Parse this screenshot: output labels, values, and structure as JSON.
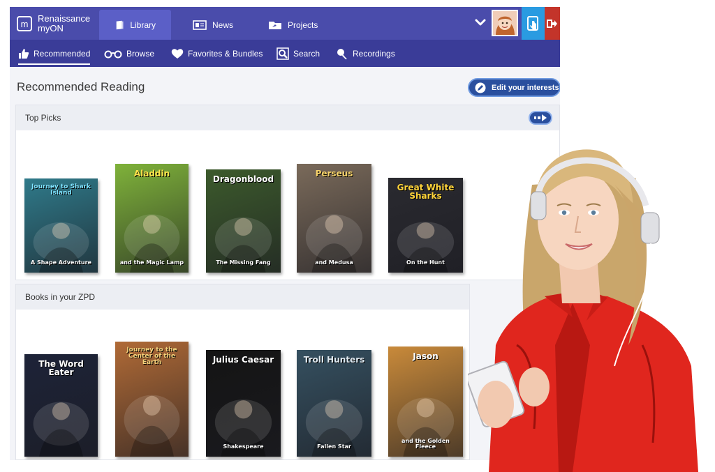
{
  "brand": {
    "line1": "Renaissance",
    "line2": "myON"
  },
  "main_tabs": [
    {
      "label": "Library",
      "icon": "book-icon",
      "active": true
    },
    {
      "label": "News",
      "icon": "newspaper-icon",
      "active": false
    },
    {
      "label": "Projects",
      "icon": "folder-icon",
      "active": false
    }
  ],
  "sub_nav": [
    {
      "label": "Recommended",
      "icon": "thumbs-up-icon",
      "active": true
    },
    {
      "label": "Browse",
      "icon": "glasses-icon"
    },
    {
      "label": "Favorites & Bundles",
      "icon": "heart-icon"
    },
    {
      "label": "Search",
      "icon": "search-icon"
    },
    {
      "label": "Recordings",
      "icon": "microphone-icon"
    }
  ],
  "page": {
    "title": "Recommended Reading",
    "edit_interests_label": "Edit your interests"
  },
  "sections": [
    {
      "title": "Top Picks",
      "books": [
        {
          "title": "Journey to Shark Island",
          "subtitle": "A Shape Adventure",
          "color": "#2f7a8a"
        },
        {
          "title": "Aladdin",
          "subtitle": "and the Magic Lamp",
          "color": "#7fb23a"
        },
        {
          "title": "Dragonblood",
          "subtitle": "The Missing Fang",
          "color": "#3c5a2c"
        },
        {
          "title": "Perseus",
          "subtitle": "and Medusa",
          "color": "#7a6a5a"
        },
        {
          "title": "Great White Sharks",
          "subtitle": "On the Hunt",
          "color": "#2a2a30"
        }
      ]
    },
    {
      "title": "Books in your ZPD",
      "books": [
        {
          "title": "The Word Eater",
          "subtitle": "",
          "color": "#1d2338"
        },
        {
          "title": "Journey to the Center of the Earth",
          "subtitle": "",
          "color": "#b06a36"
        },
        {
          "title": "Julius Caesar",
          "subtitle": "Shakespeare",
          "color": "#141414"
        },
        {
          "title": "Troll Hunters",
          "subtitle": "Fallen Star",
          "color": "#355060"
        },
        {
          "title": "Jason",
          "subtitle": "and the Golden Fleece",
          "color": "#c98a3a"
        }
      ]
    }
  ],
  "colors": {
    "topbar": "#4a4cab",
    "subnav": "#3a3c98",
    "accent_button": "#2a4f9e",
    "focus_button": "#2a9be1",
    "logout_button": "#c3342a"
  }
}
